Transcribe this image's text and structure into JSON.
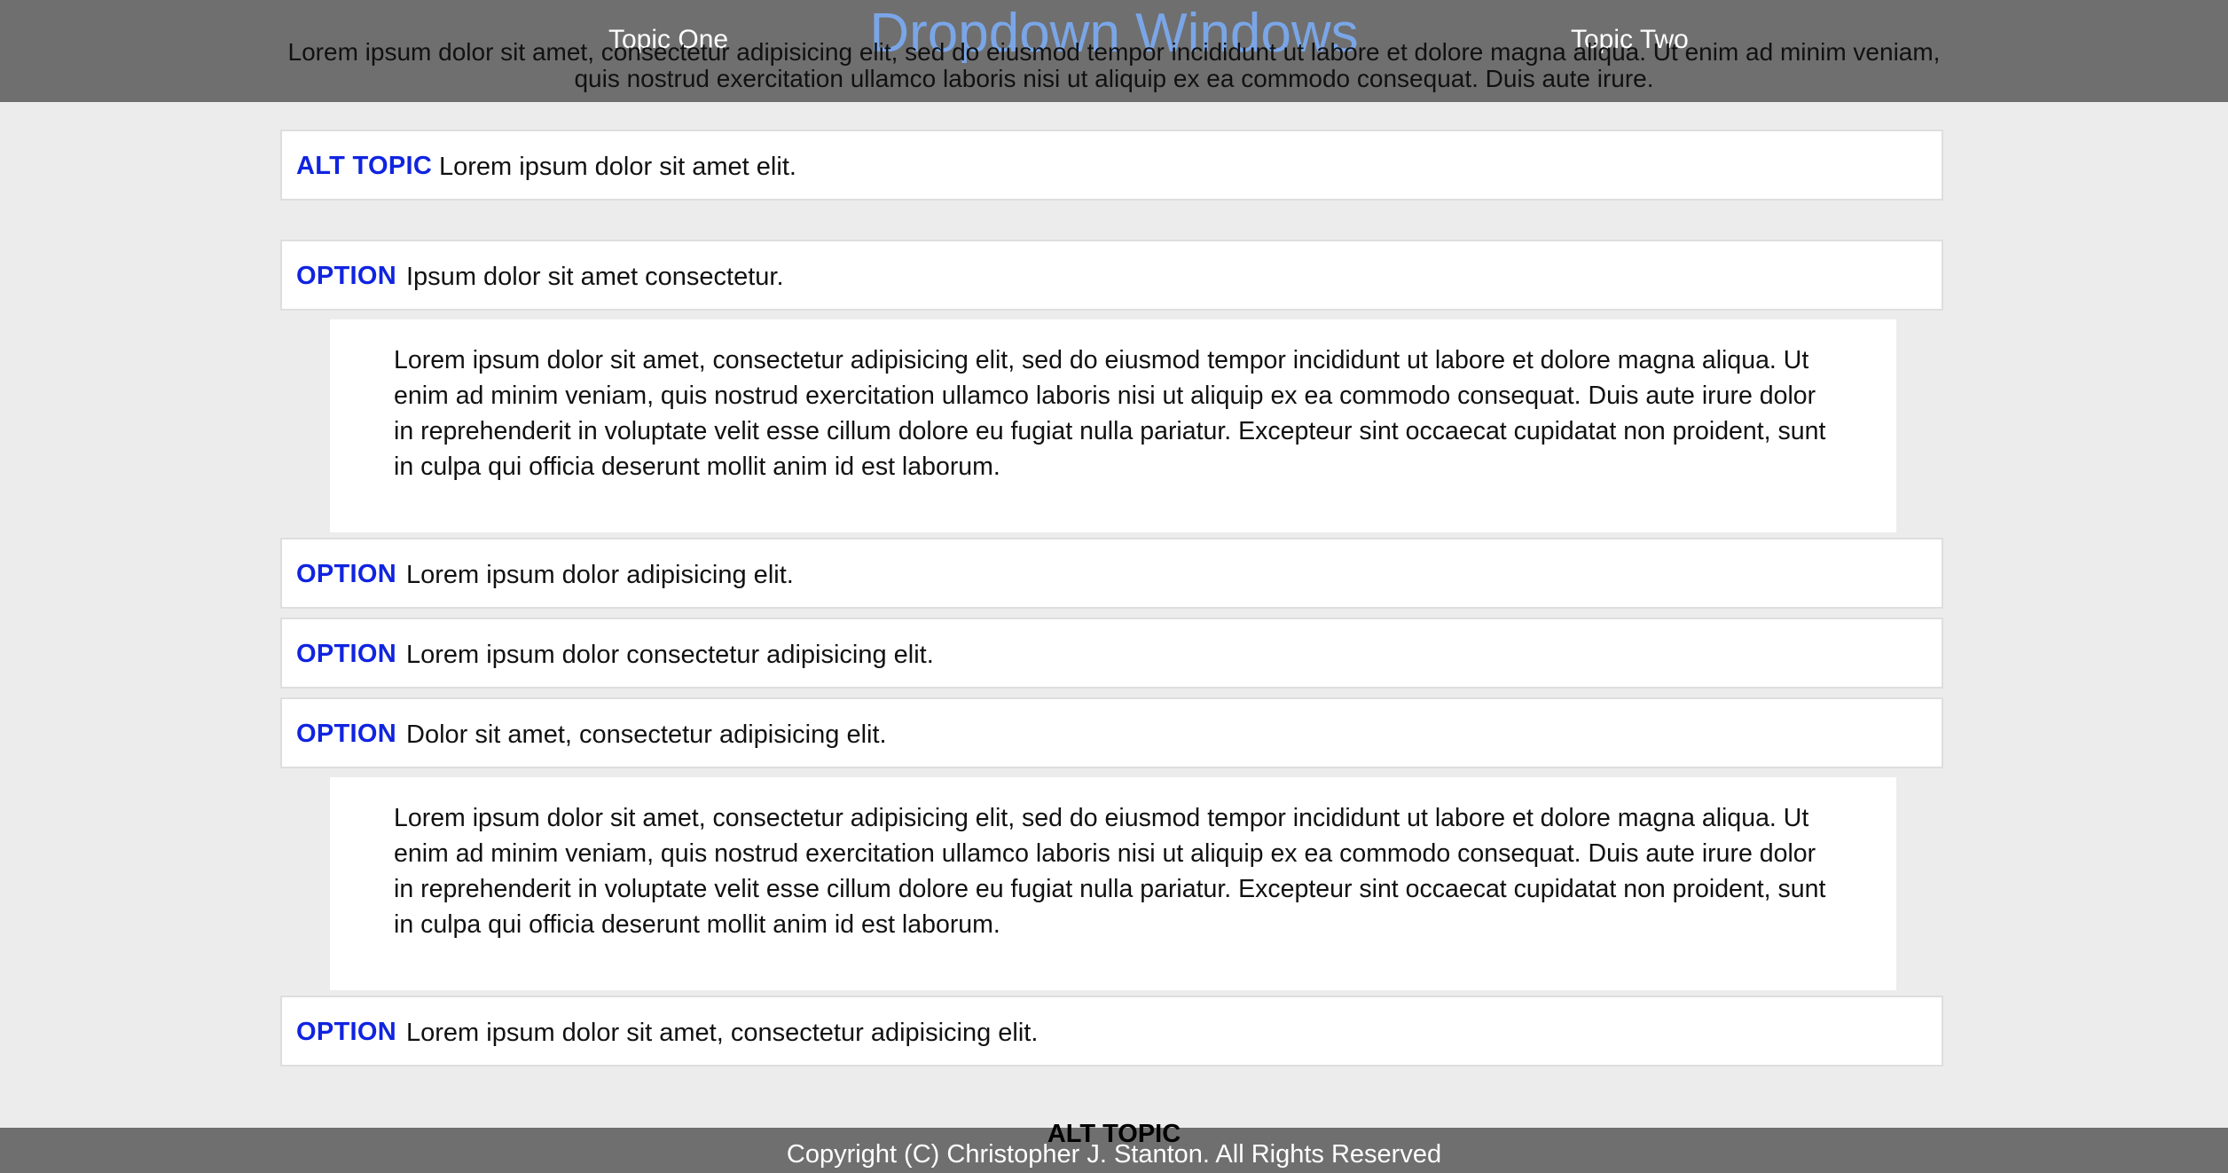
{
  "header": {
    "title": "Dropdown Windows",
    "nav": [
      "Topic One",
      "Topic Two"
    ],
    "intro": "Lorem ipsum dolor sit amet, consectetur adipisicing elit, sed do eiusmod tempor incididunt ut labore et dolore magna aliqua. Ut enim ad minim veniam, quis nostrud exercitation ullamco laboris nisi ut aliquip ex ea commodo consequat. Duis aute irure.",
    "accent_color": "#7aa6e8",
    "bar_color": "#6f6f6f"
  },
  "accordion": {
    "tag_color": "#1024e0",
    "items": [
      {
        "tag": "ALT TOPIC",
        "label": "Lorem ipsum dolor sit amet elit.",
        "expanded": false
      },
      {
        "tag": "OPTION",
        "label": "Ipsum dolor sit amet consectetur.",
        "expanded": true,
        "content": "Lorem ipsum dolor sit amet, consectetur adipisicing elit, sed do eiusmod tempor incididunt ut labore et dolore magna aliqua. Ut enim ad minim veniam, quis nostrud exercitation ullamco laboris nisi ut aliquip ex ea commodo consequat. Duis aute irure dolor in reprehenderit in voluptate velit esse cillum dolore eu fugiat nulla pariatur. Excepteur sint occaecat cupidatat non proident, sunt in culpa qui officia deserunt mollit anim id est laborum."
      },
      {
        "tag": "OPTION",
        "label": "Lorem ipsum dolor adipisicing elit.",
        "expanded": false
      },
      {
        "tag": "OPTION",
        "label": "Lorem ipsum dolor consectetur adipisicing elit.",
        "expanded": false
      },
      {
        "tag": "OPTION",
        "label": "Dolor sit amet, consectetur adipisicing elit.",
        "expanded": true,
        "content": "Lorem ipsum dolor sit amet, consectetur adipisicing elit, sed do eiusmod tempor incididunt ut labore et dolore magna aliqua. Ut enim ad minim veniam, quis nostrud exercitation ullamco laboris nisi ut aliquip ex ea commodo consequat. Duis aute irure dolor in reprehenderit in voluptate velit esse cillum dolore eu fugiat nulla pariatur. Excepteur sint occaecat cupidatat non proident, sunt in culpa qui officia deserunt mollit anim id est laborum."
      },
      {
        "tag": "OPTION",
        "label": "Lorem ipsum dolor sit amet, consectetur adipisicing elit.",
        "expanded": false
      }
    ]
  },
  "footer": {
    "alt_topic": "ALT TOPIC",
    "copyright": "Copyright (C) Christopher J. Stanton. All Rights Reserved"
  }
}
